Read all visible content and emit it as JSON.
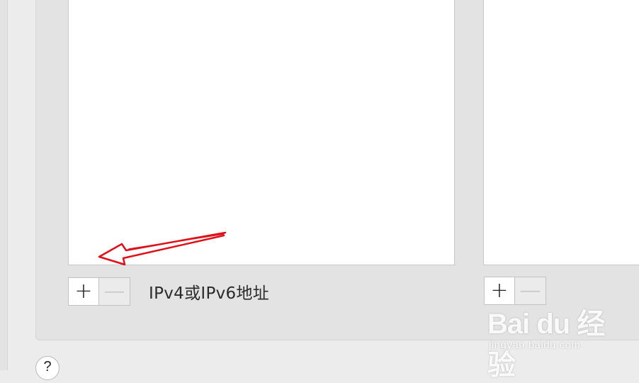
{
  "address_list": {
    "add_label": "+",
    "remove_label": "—",
    "hint": "IPv4或IPv6地址"
  },
  "second_list": {
    "add_label": "+",
    "remove_label": "—"
  },
  "help": {
    "label": "?"
  },
  "watermark": {
    "logo_text": "Bai du 经验",
    "url": "jingyan.baidu.com"
  },
  "annotation": {
    "arrow_color": "#e0101a"
  },
  "icons": {
    "add": "plus-icon",
    "remove": "minus-icon",
    "help": "question-icon"
  }
}
